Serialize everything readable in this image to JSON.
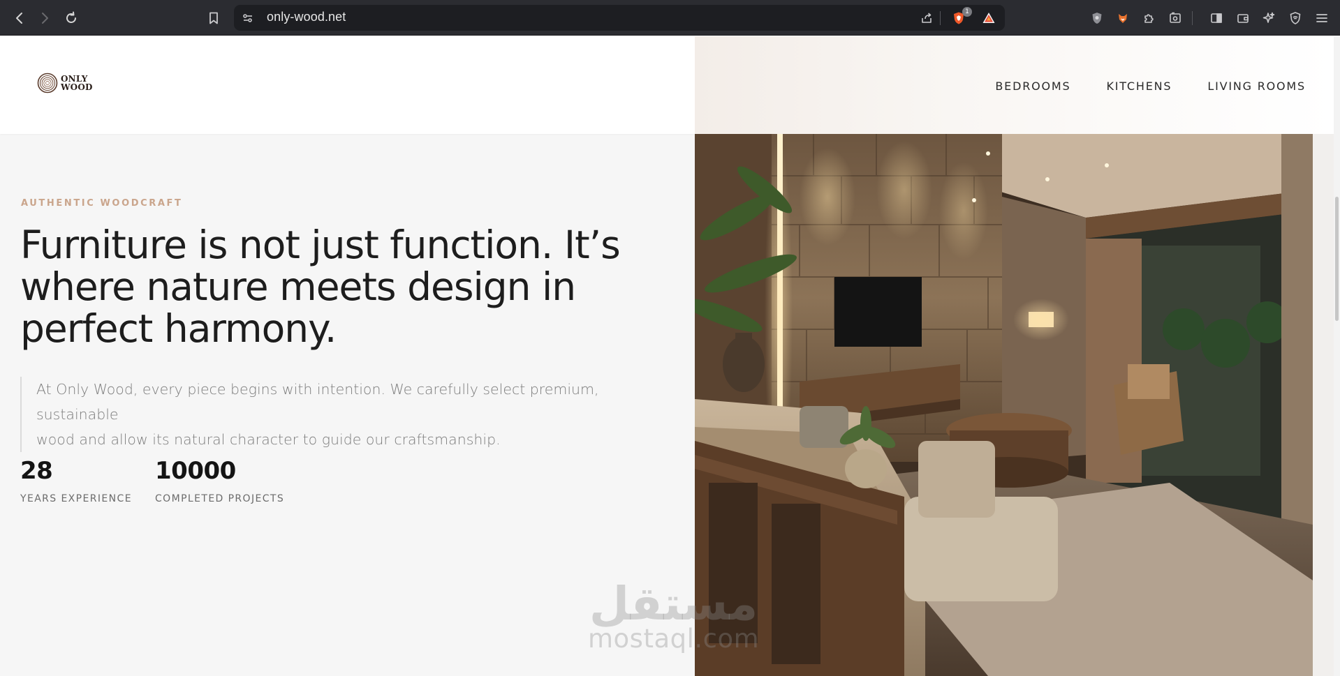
{
  "browser": {
    "url": "only-wood.net",
    "brave_shields_count": "1",
    "icons": [
      "back-icon",
      "forward-icon",
      "reload-icon",
      "bookmark-icon",
      "site-settings-icon",
      "share-icon",
      "brave-shields-icon",
      "brave-rewards-icon",
      "shield-extension-icon",
      "fox-extension-icon",
      "extensions-icon",
      "screenshot-icon",
      "sidebar-icon",
      "wallet-icon",
      "leo-ai-icon",
      "vpn-icon",
      "menu-icon"
    ]
  },
  "header": {
    "logo_line1": "ONLY",
    "logo_line2": "WOOD",
    "nav": [
      "BEDROOMS",
      "KITCHENS",
      "LIVING ROOMS"
    ]
  },
  "hero": {
    "eyebrow": "AUTHENTIC WOODCRAFT",
    "title_line1": "Furniture is not just function. It’s",
    "title_line2": "where nature meets design in",
    "title_line3": "perfect harmony.",
    "quote_line1": "At Only Wood, every piece begins with intention. We carefully select premium, sustainable",
    "quote_line2": "wood and allow its natural character to guide our craftsmanship.",
    "stats": [
      {
        "value": "28",
        "label": "YEARS EXPERIENCE"
      },
      {
        "value": "10000",
        "label": "COMPLETED PROJECTS"
      }
    ]
  },
  "watermark": {
    "arabic": "مستقل",
    "latin": "mostaql.com"
  },
  "colors": {
    "accent": "#caa58c",
    "text_dark": "#1d1d1d",
    "page_bg": "#f6f6f6",
    "chrome_bg": "#2b2c31"
  }
}
